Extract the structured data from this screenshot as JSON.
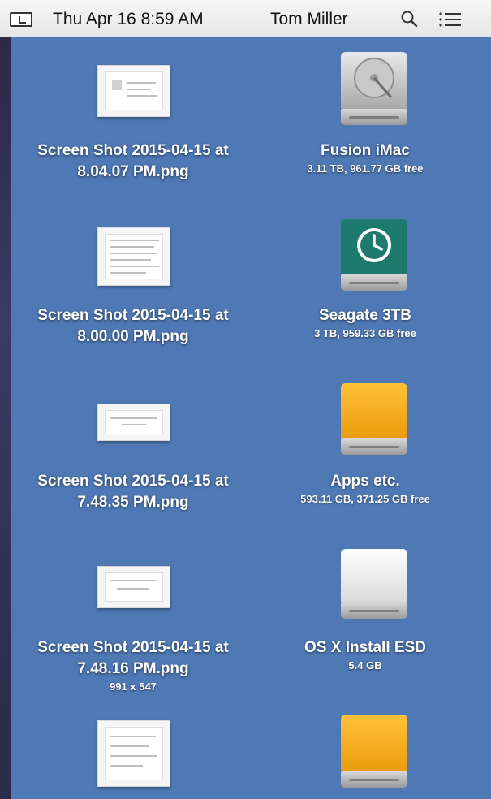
{
  "menubar": {
    "datetime": "Thu Apr 16  8:59 AM",
    "user": "Tom Miller",
    "icons": [
      "app-switch-icon",
      "search-icon",
      "list-icon"
    ]
  },
  "files": [
    {
      "name_line1": "Screen Shot 2015-04-15 at",
      "name_line2": "8.04.07 PM.png",
      "info": ""
    },
    {
      "name_line1": "Screen Shot 2015-04-15 at",
      "name_line2": "8.00.00 PM.png",
      "info": ""
    },
    {
      "name_line1": "Screen Shot 2015-04-15 at",
      "name_line2": "7.48.35 PM.png",
      "info": ""
    },
    {
      "name_line1": "Screen Shot 2015-04-15 at",
      "name_line2": "7.48.16 PM.png",
      "info": "991 x 547"
    }
  ],
  "drives": [
    {
      "name": "Fusion iMac",
      "info": "3.11 TB, 961.77 GB free",
      "icon": "hard-drive-icon"
    },
    {
      "name": "Seagate 3TB",
      "info": "3 TB, 959.33 GB free",
      "icon": "time-machine-drive-icon"
    },
    {
      "name": "Apps etc.",
      "info": "593.11 GB, 371.25 GB free",
      "icon": "external-drive-icon"
    },
    {
      "name": "OS X Install ESD",
      "info": "5.4 GB",
      "icon": "white-disk-icon"
    }
  ],
  "colors": {
    "desktop": "#4f79b5",
    "orange_drive": "#f2a818",
    "teal_drive": "#1f7a6e"
  }
}
